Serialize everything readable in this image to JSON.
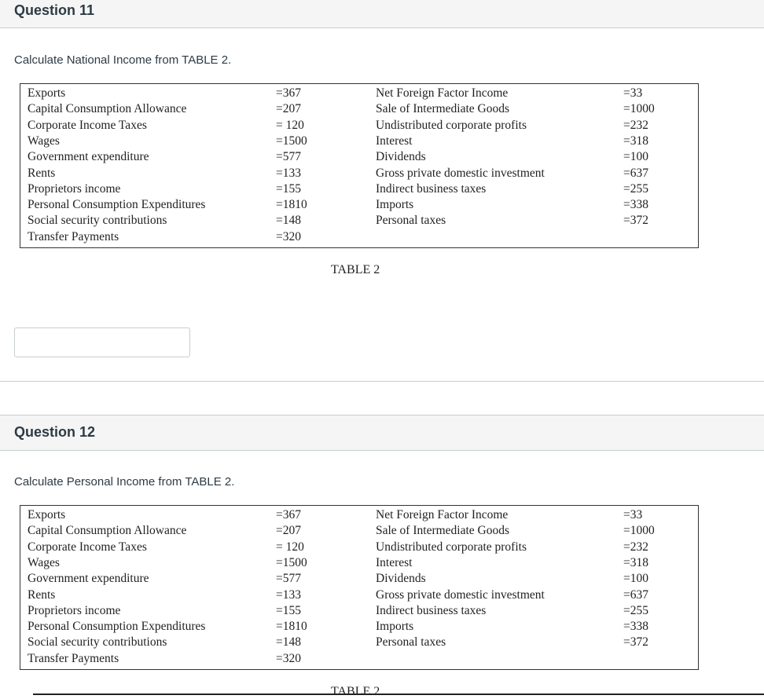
{
  "questions": [
    {
      "title": "Question 11",
      "prompt": "Calculate National Income from TABLE 2.",
      "answer_value": "",
      "caption": "TABLE 2"
    },
    {
      "title": "Question 12",
      "prompt": "Calculate Personal Income from TABLE 2.",
      "caption": "TABLE 2"
    }
  ],
  "table": {
    "rows": [
      {
        "label1": "Exports",
        "val1": "=367",
        "label2": "Net Foreign Factor Income",
        "val2": "=33"
      },
      {
        "label1": "Capital Consumption Allowance",
        "val1": "=207",
        "label2": "Sale of Intermediate Goods",
        "val2": "=1000"
      },
      {
        "label1": "Corporate Income Taxes",
        "val1": "= 120",
        "label2": "Undistributed corporate profits",
        "val2": "=232"
      },
      {
        "label1": "Wages",
        "val1": "=1500",
        "label2": "Interest",
        "val2": "=318"
      },
      {
        "label1": "Government expenditure",
        "val1": "=577",
        "label2": "Dividends",
        "val2": "=100"
      },
      {
        "label1": "Rents",
        "val1": "=133",
        "label2": "Gross private domestic investment",
        "val2": "=637"
      },
      {
        "label1": "Proprietors income",
        "val1": "=155",
        "label2": "Indirect business taxes",
        "val2": "=255"
      },
      {
        "label1": "Personal Consumption Expenditures",
        "val1": "=1810",
        "label2": "Imports",
        "val2": "=338"
      },
      {
        "label1": "Social security contributions",
        "val1": "=148",
        "label2": "Personal taxes",
        "val2": "=372"
      },
      {
        "label1": "Transfer Payments",
        "val1": "=320",
        "label2": "",
        "val2": ""
      }
    ]
  }
}
